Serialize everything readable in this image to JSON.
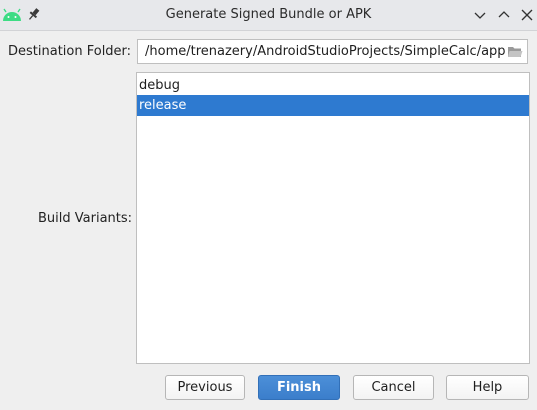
{
  "window": {
    "title": "Generate Signed Bundle or APK"
  },
  "destination": {
    "label": "Destination Folder:",
    "path": "/home/trenazery/AndroidStudioProjects/SimpleCalc/app"
  },
  "build_variants": {
    "label": "Build Variants:",
    "items": [
      {
        "label": "debug",
        "selected": false
      },
      {
        "label": "release",
        "selected": true
      }
    ]
  },
  "buttons": {
    "previous": "Previous",
    "finish": "Finish",
    "cancel": "Cancel",
    "help": "Help"
  },
  "colors": {
    "selection": "#2e7ad0",
    "primary_button": "#3b7ecb",
    "android_green": "#3ddc84"
  }
}
